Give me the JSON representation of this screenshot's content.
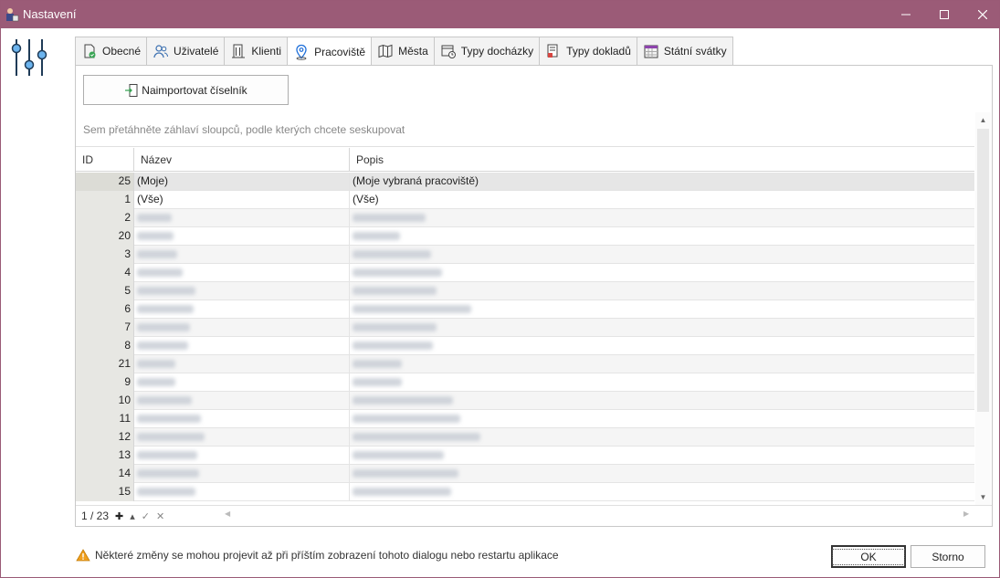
{
  "window": {
    "title": "Nastavení"
  },
  "tabs": [
    {
      "label": "Obecné",
      "icon": "document-check-icon"
    },
    {
      "label": "Uživatelé",
      "icon": "users-icon"
    },
    {
      "label": "Klienti",
      "icon": "building-icon"
    },
    {
      "label": "Pracoviště",
      "icon": "location-pin-icon",
      "active": true
    },
    {
      "label": "Města",
      "icon": "map-icon"
    },
    {
      "label": "Typy docházky",
      "icon": "attendance-icon"
    },
    {
      "label": "Typy dokladů",
      "icon": "documents-icon"
    },
    {
      "label": "Státní svátky",
      "icon": "calendar-icon"
    }
  ],
  "toolbar": {
    "import_label": "Naimportovat číselník"
  },
  "grid": {
    "group_hint": "Sem přetáhněte záhlaví sloupců, podle kterých chcete seskupovat",
    "columns": {
      "id": "ID",
      "nazev": "Název",
      "popis": "Popis"
    },
    "rows": [
      {
        "id": "25",
        "nazev": "(Moje)",
        "popis": "(Moje vybraná pracoviště)"
      },
      {
        "id": "1",
        "nazev": "(Vše)",
        "popis": "(Vše)"
      },
      {
        "id": "2"
      },
      {
        "id": "20"
      },
      {
        "id": "3"
      },
      {
        "id": "4"
      },
      {
        "id": "5"
      },
      {
        "id": "6"
      },
      {
        "id": "7"
      },
      {
        "id": "8"
      },
      {
        "id": "21"
      },
      {
        "id": "9"
      },
      {
        "id": "10"
      },
      {
        "id": "11"
      },
      {
        "id": "12"
      },
      {
        "id": "13"
      },
      {
        "id": "14"
      },
      {
        "id": "15"
      }
    ],
    "pager": {
      "position": "1 / 23"
    }
  },
  "footer": {
    "note": "Některé změny se mohou projevit až při příštím zobrazení tohoto dialogu nebo restartu aplikace",
    "ok_label": "OK",
    "cancel_label": "Storno"
  },
  "colors": {
    "titlebar": "#9b5b77",
    "accent": "#1e6fd9"
  }
}
